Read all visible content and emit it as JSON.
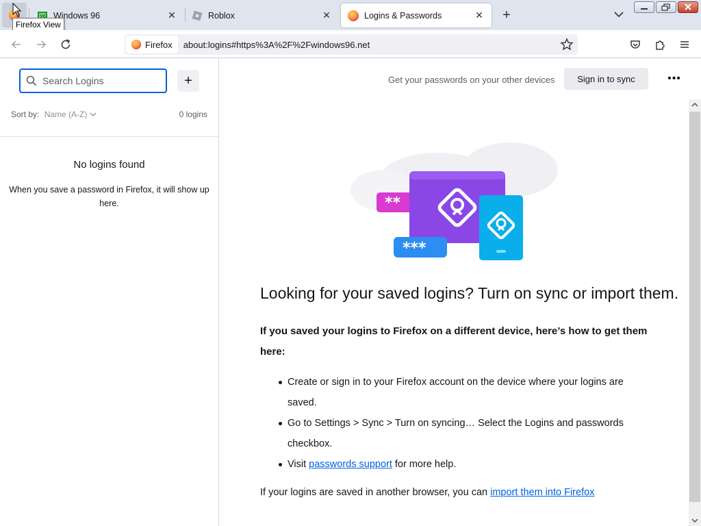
{
  "tabs": [
    {
      "label": "Windows 96"
    },
    {
      "label": "Roblox"
    },
    {
      "label": "Logins & Passwords"
    }
  ],
  "tooltip": "Firefox View",
  "urlbar": {
    "identity": "Firefox",
    "url": "about:logins#https%3A%2F%2Fwindows96.net"
  },
  "sidebar": {
    "search_placeholder": "Search Logins",
    "sort_label": "Sort by:",
    "sort_value": "Name (A-Z)",
    "count": "0 logins",
    "empty_title": "No logins found",
    "empty_desc": "When you save a password in Firefox, it will show up here."
  },
  "main": {
    "sync_text": "Get your passwords on your other devices",
    "sync_button": "Sign in to sync",
    "heading": "Looking for your saved logins? Turn on sync or import them.",
    "intro": "If you saved your logins to Firefox on a different device, here’s how to get them here:",
    "step1": "Create or sign in to your Firefox account on the device where your logins are saved.",
    "step2": "Go to Settings > Sync > Turn on syncing… Select the Logins and passwords checkbox.",
    "step3_prefix": "Visit ",
    "step3_link": "passwords support",
    "step3_suffix": " for more help.",
    "outro_prefix": "If your logins are saved in another browser, you can ",
    "outro_link": "import them into Firefox"
  },
  "colors": {
    "accent": "#0061e0",
    "illustration_purple": "#8a47e6",
    "illustration_blue": "#0aaeea",
    "illustration_pink": "#d93ad0"
  }
}
